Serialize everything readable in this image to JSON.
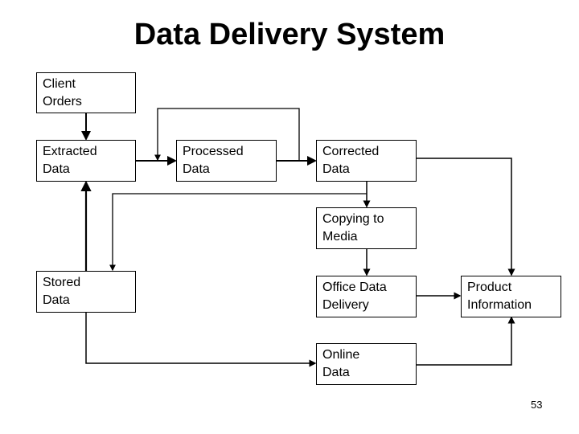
{
  "title": "Data Delivery System",
  "page_number": "53",
  "nodes": {
    "client_orders": {
      "line1": "Client",
      "line2": "Orders"
    },
    "extracted_data": {
      "line1": "Extracted",
      "line2": "Data"
    },
    "processed_data": {
      "line1": "Processed",
      "line2": "Data"
    },
    "corrected_data": {
      "line1": "Corrected",
      "line2": "Data"
    },
    "copying_to_media": {
      "line1": "Copying to",
      "line2": "Media"
    },
    "stored_data": {
      "line1": "Stored",
      "line2": "Data"
    },
    "office_data_delivery": {
      "line1": "Office Data",
      "line2": "Delivery"
    },
    "product_information": {
      "line1": "Product",
      "line2": "Information"
    },
    "online_data": {
      "line1": "Online",
      "line2": "Data"
    }
  },
  "edges": [
    {
      "from": "Client Orders",
      "to": "Extracted Data"
    },
    {
      "from": "Extracted Data",
      "to": "Processed Data"
    },
    {
      "from": "Processed Data",
      "to": "Processed Data (feedback loop)"
    },
    {
      "from": "Processed Data",
      "to": "Corrected Data"
    },
    {
      "from": "Corrected Data",
      "to": "Copying to Media"
    },
    {
      "from": "Corrected Data",
      "to": "Stored Data"
    },
    {
      "from": "Corrected Data",
      "to": "Product Information"
    },
    {
      "from": "Stored Data",
      "to": "Extracted Data"
    },
    {
      "from": "Stored Data",
      "to": "Online Data"
    },
    {
      "from": "Copying to Media",
      "to": "Office Data Delivery"
    },
    {
      "from": "Office Data Delivery",
      "to": "Product Information"
    },
    {
      "from": "Online Data",
      "to": "Product Information"
    }
  ]
}
